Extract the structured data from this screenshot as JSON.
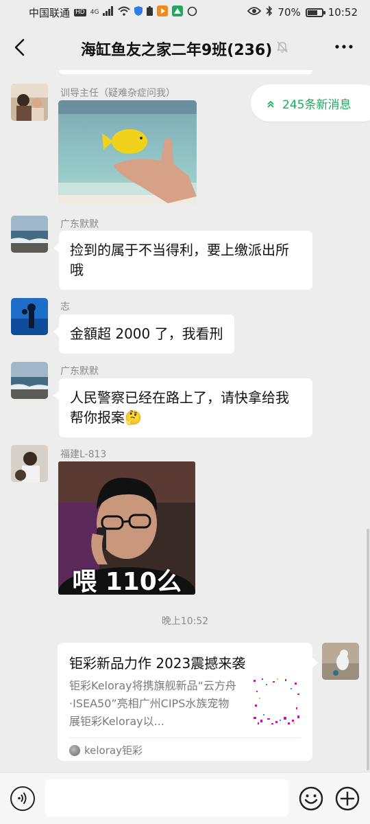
{
  "status_bar": {
    "carrier": "中国联通",
    "hd_label": "HD",
    "net_label": "4G",
    "battery_percent": "70%",
    "battery_level": 0.7,
    "time": "10:52"
  },
  "header": {
    "title": "海缸鱼友之家二年9班(236)",
    "back_icon": "chevron-left-icon",
    "mute_icon": "bell-off-icon",
    "more_icon": "more-dots-icon"
  },
  "new_messages": {
    "label": "245条新消息",
    "icon": "double-chevron-up-icon"
  },
  "messages": [
    {
      "sender": "训导主任（疑难杂症问我）",
      "type": "image",
      "image_desc_icon": "fish-hand-photo"
    },
    {
      "sender": "广东默默",
      "type": "text",
      "text": "捡到的属于不当得利，要上缴派出所哦"
    },
    {
      "sender": "志",
      "type": "text",
      "text": "金額超 2000 了，我看刑"
    },
    {
      "sender": "广东默默",
      "type": "text",
      "text": "人民警察已经在路上了，请快拿给我帮你报案🤔"
    },
    {
      "sender": "福建L-813",
      "type": "image",
      "image_caption": "喂 110么"
    }
  ],
  "timestamp": "晚上10:52",
  "link_card": {
    "title": "钜彩新品力作 2023震撼来袭",
    "description": "钜彩Keloray将携旗舰新品“云方舟·ISEA50”亮相广州CIPS水族宠物展钜彩Keloray以...",
    "source": "keloray钜彩"
  },
  "input_bar": {
    "voice_icon": "voice-icon",
    "emoji_icon": "emoji-icon",
    "plus_icon": "plus-circle-icon",
    "placeholder": ""
  },
  "colors": {
    "background": "#ededed",
    "accent_green": "#1aad5c",
    "bubble": "#ffffff"
  }
}
